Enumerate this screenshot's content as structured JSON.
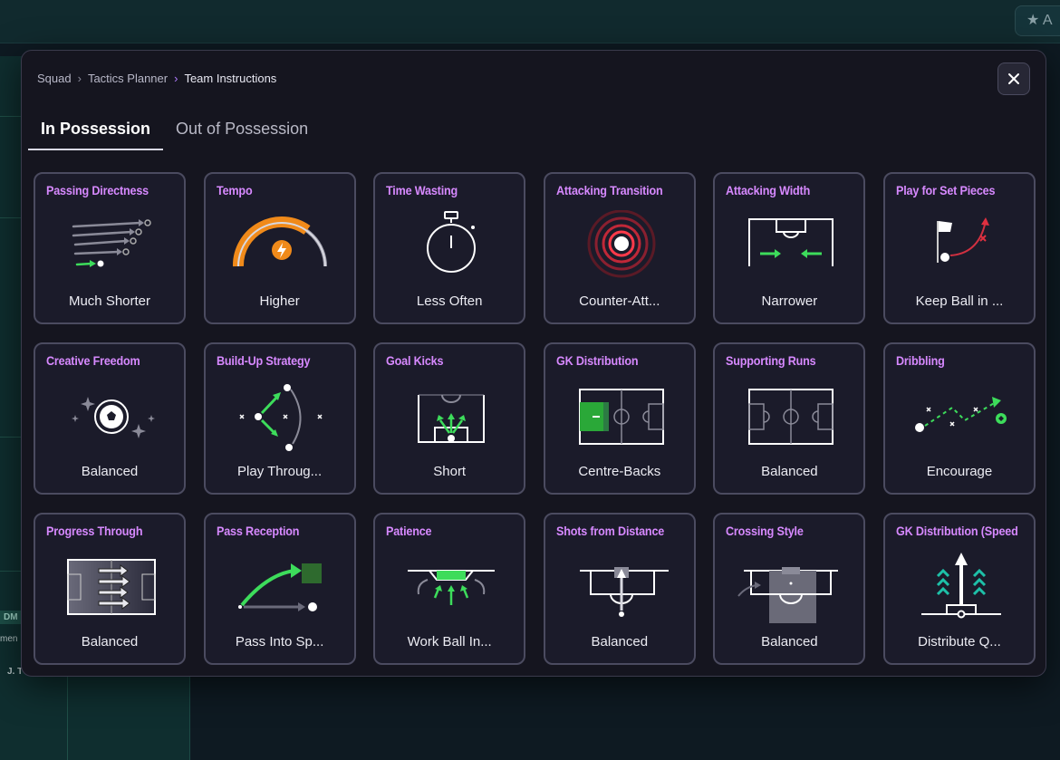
{
  "background": {
    "fav_icon": "star-icon",
    "fav_text": "A",
    "tag": "DM",
    "small_text": "men",
    "player": "J. T"
  },
  "modal": {
    "breadcrumb": [
      "Squad",
      "Tactics Planner",
      "Team Instructions"
    ],
    "close_icon": "close-icon",
    "tabs": [
      {
        "label": "In Possession",
        "active": true
      },
      {
        "label": "Out of Possession",
        "active": false
      }
    ],
    "cards": [
      {
        "title": "Passing Directness",
        "value": "Much Shorter",
        "icon": "passing-directness-icon"
      },
      {
        "title": "Tempo",
        "value": "Higher",
        "icon": "tempo-gauge-icon"
      },
      {
        "title": "Time Wasting",
        "value": "Less Often",
        "icon": "stopwatch-icon"
      },
      {
        "title": "Attacking Transition",
        "value": "Counter-Att...",
        "icon": "counter-attack-target-icon"
      },
      {
        "title": "Attacking Width",
        "value": "Narrower",
        "icon": "attacking-width-icon"
      },
      {
        "title": "Play for Set Pieces",
        "value": "Keep Ball in ...",
        "icon": "set-pieces-flag-icon"
      },
      {
        "title": "Creative Freedom",
        "value": "Balanced",
        "icon": "creative-freedom-ball-icon"
      },
      {
        "title": "Build-Up Strategy",
        "value": "Play Throug...",
        "icon": "build-up-strategy-icon"
      },
      {
        "title": "Goal Kicks",
        "value": "Short",
        "icon": "goal-kicks-icon"
      },
      {
        "title": "GK Distribution",
        "value": "Centre-Backs",
        "icon": "gk-distribution-pitch-icon"
      },
      {
        "title": "Supporting Runs",
        "value": "Balanced",
        "icon": "supporting-runs-pitch-icon"
      },
      {
        "title": "Dribbling",
        "value": "Encourage",
        "icon": "dribbling-icon"
      },
      {
        "title": "Progress Through",
        "value": "Balanced",
        "icon": "progress-through-icon"
      },
      {
        "title": "Pass Reception",
        "value": "Pass Into Sp...",
        "icon": "pass-reception-icon"
      },
      {
        "title": "Patience",
        "value": "Work Ball In...",
        "icon": "patience-icon"
      },
      {
        "title": "Shots from Distance",
        "value": "Balanced",
        "icon": "shots-from-distance-icon"
      },
      {
        "title": "Crossing Style",
        "value": "Balanced",
        "icon": "crossing-style-icon"
      },
      {
        "title": "GK Distribution (Speed",
        "value": "Distribute Q...",
        "icon": "gk-distribution-speed-icon"
      }
    ]
  }
}
